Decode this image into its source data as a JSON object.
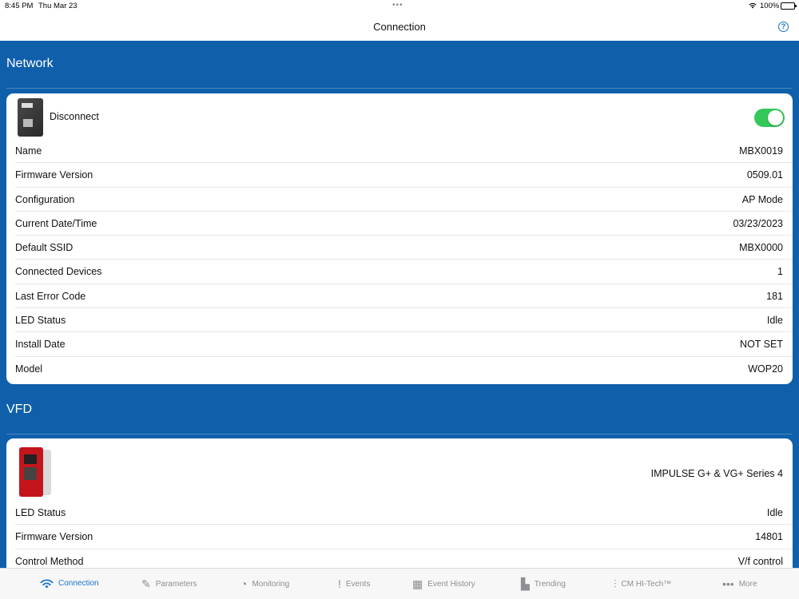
{
  "status_bar": {
    "time": "8:45 PM",
    "date": "Thu Mar 23",
    "battery": "100%"
  },
  "nav": {
    "title": "Connection",
    "help_icon": "question-circle-icon"
  },
  "network": {
    "header": "Network",
    "device_label": "Disconnect",
    "toggle_on": true,
    "rows": [
      {
        "label": "Name",
        "value": "MBX0019"
      },
      {
        "label": "Firmware Version",
        "value": "0509.01"
      },
      {
        "label": "Configuration",
        "value": "AP Mode"
      },
      {
        "label": "Current Date/Time",
        "value": "03/23/2023"
      },
      {
        "label": "Default SSID",
        "value": "MBX0000"
      },
      {
        "label": "Connected Devices",
        "value": "1"
      },
      {
        "label": "Last Error Code",
        "value": "181"
      },
      {
        "label": "LED Status",
        "value": "Idle"
      },
      {
        "label": "Install Date",
        "value": "NOT SET"
      },
      {
        "label": "Model",
        "value": "WOP20"
      }
    ]
  },
  "vfd": {
    "header": "VFD",
    "device_name": "IMPULSE G+ & VG+ Series 4",
    "rows": [
      {
        "label": "LED Status",
        "value": "Idle"
      },
      {
        "label": "Firmware Version",
        "value": "14801"
      },
      {
        "label": "Control Method",
        "value": "V/f control"
      }
    ]
  },
  "tabs": [
    {
      "label": "Connection",
      "icon": "wifi-icon",
      "active": true
    },
    {
      "label": "Parameters",
      "icon": "pencil-icon",
      "active": false
    },
    {
      "label": "Monitoring",
      "icon": "gauge-icon",
      "active": false
    },
    {
      "label": "Events",
      "icon": "exclamation-icon",
      "active": false
    },
    {
      "label": "Event History",
      "icon": "calendar-icon",
      "active": false
    },
    {
      "label": "Trending",
      "icon": "bar-chart-icon",
      "active": false
    },
    {
      "label": "CM HI-Tech™",
      "icon": "sliders-icon",
      "active": false
    },
    {
      "label": "More",
      "icon": "ellipsis-icon",
      "active": false
    }
  ],
  "colors": {
    "accent": "#1a73c9",
    "section_background": "#0f5fab",
    "toggle_on": "#34c759"
  }
}
